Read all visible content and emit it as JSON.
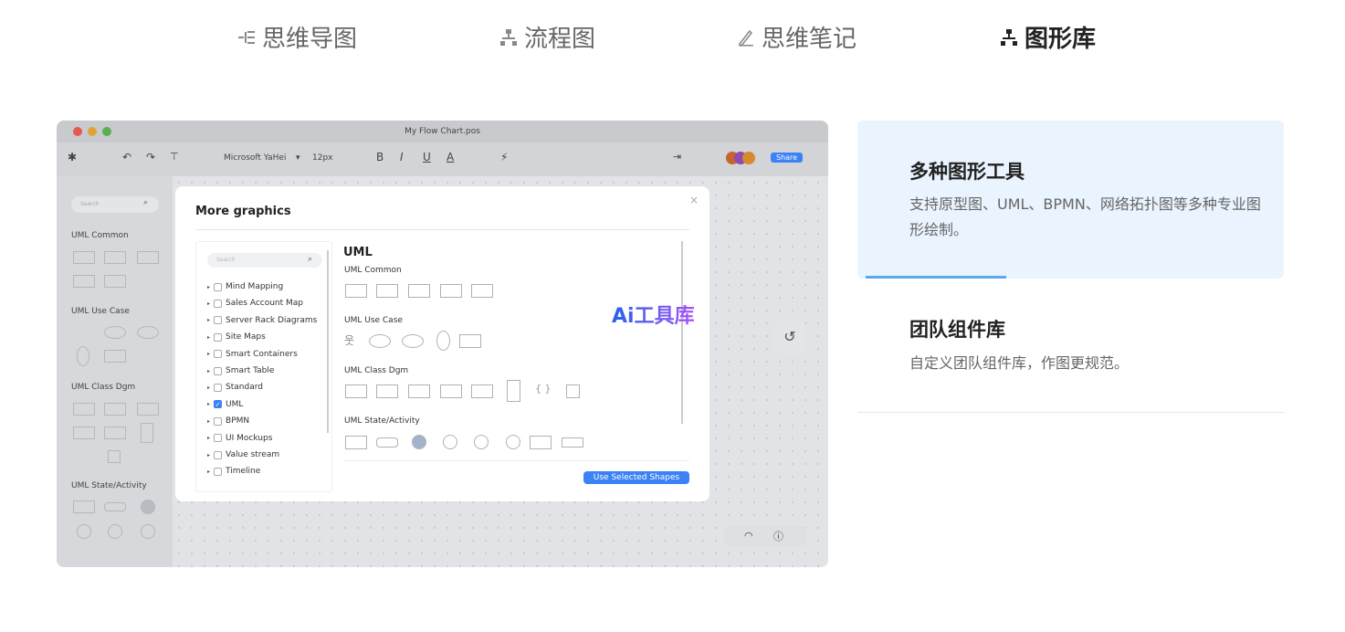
{
  "tabs": [
    {
      "label": "思维导图",
      "icon": "mindmap-icon"
    },
    {
      "label": "流程图",
      "icon": "flowchart-icon"
    },
    {
      "label": "思维笔记",
      "icon": "pen-icon"
    },
    {
      "label": "图形库",
      "icon": "shape-library-icon",
      "active": true
    }
  ],
  "app": {
    "window_title": "My Flow Chart.pos",
    "font": "Microsoft YaHei",
    "font_size": "12px",
    "share": "Share",
    "toolbar_text": {
      "b": "B",
      "i": "I",
      "u": "U",
      "a": "A"
    },
    "left_search": "Search",
    "left_sections": [
      "UML Common",
      "UML Use Case",
      "UML Class Dgm",
      "UML State/Activity"
    ]
  },
  "modal": {
    "title": "More graphics",
    "close": "×",
    "search": "Search",
    "categories": [
      {
        "label": "Mind Mapping",
        "checked": false
      },
      {
        "label": "Sales Account Map",
        "checked": false
      },
      {
        "label": "Server Rack Diagrams",
        "checked": false
      },
      {
        "label": "Site Maps",
        "checked": false
      },
      {
        "label": "Smart Containers",
        "checked": false
      },
      {
        "label": "Smart Table",
        "checked": false
      },
      {
        "label": "Standard",
        "checked": false
      },
      {
        "label": "UML",
        "checked": true
      },
      {
        "label": "BPMN",
        "checked": false
      },
      {
        "label": "UI Mockups",
        "checked": false
      },
      {
        "label": "Value stream",
        "checked": false
      },
      {
        "label": "Timeline",
        "checked": false
      }
    ],
    "heading": "UML",
    "sections": [
      "UML Common",
      "UML Use Case",
      "UML Class Dgm",
      "UML State/Activity"
    ],
    "button": "Use Selected Shapes"
  },
  "watermark": "Ai工具库",
  "features": [
    {
      "title": "多种图形工具",
      "desc": "支持原型图、UML、BPMN、网络拓扑图等多种专业图形绘制。",
      "active": true
    },
    {
      "title": "团队组件库",
      "desc": "自定义团队组件库，作图更规范。",
      "active": false
    }
  ],
  "colors": {
    "accent": "#3b82f6",
    "active_bg": "#eaf4fe",
    "progress": "#5ba8ee"
  }
}
